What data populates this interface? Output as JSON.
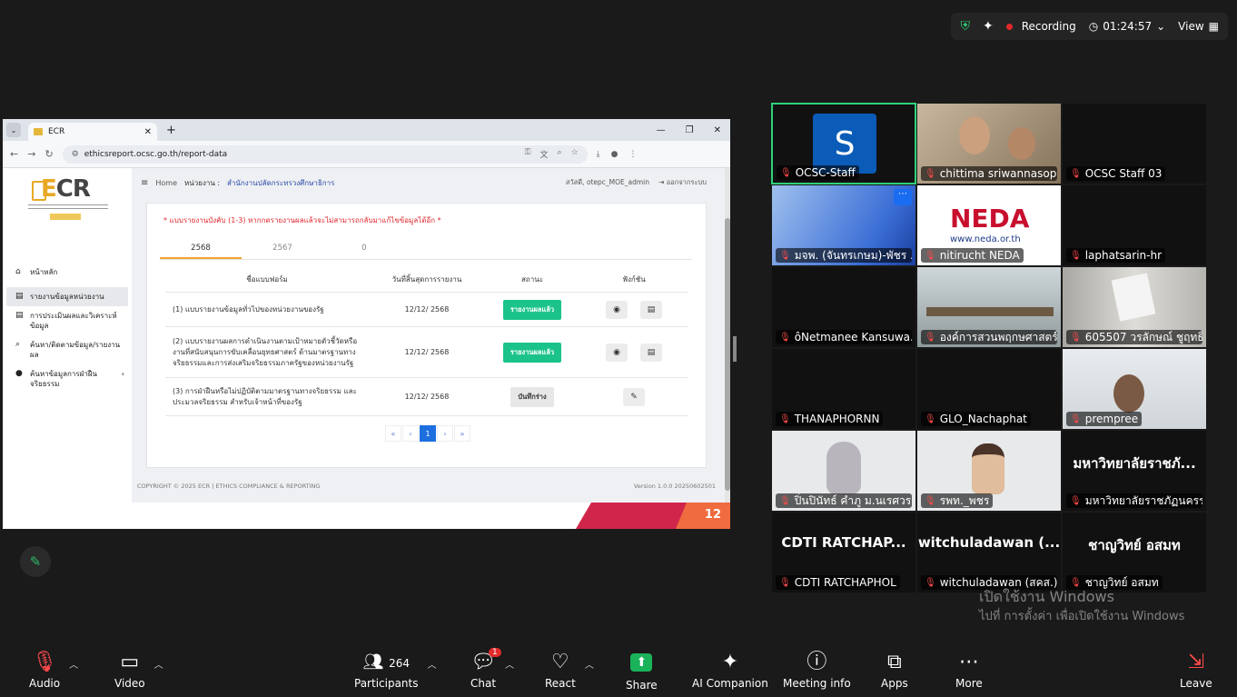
{
  "topbar": {
    "recording": "Recording",
    "timer": "01:24:57",
    "view": "View"
  },
  "browser": {
    "tab_title": "ECR",
    "url": "ethicsreport.ocsc.go.th/report-data"
  },
  "page": {
    "breadcrumb": {
      "home": "Home",
      "unit_label": "หน่วยงาน :",
      "org": "สำนักงานปลัดกระทรวงศึกษาธิการ"
    },
    "user": {
      "greeting": "สวัสดี, otepc_MOE_admin",
      "logout": "ออกจากระบบ"
    },
    "logo": {
      "text_e": "E",
      "text_rest": "CR"
    },
    "menu": [
      {
        "icon": "home-icon",
        "glyph": "⌂",
        "label": "หน้าหลัก"
      },
      {
        "icon": "document-icon",
        "glyph": "▤",
        "label": "รายงานข้อมูลหน่วยงาน"
      },
      {
        "icon": "document-icon",
        "glyph": "▤",
        "label": "การประเมินผลและวิเคราะห์ข้อมูล"
      },
      {
        "icon": "search-icon",
        "glyph": "⌕",
        "label": "ค้นหา/ติดตามข้อมูล/รายงานผล"
      },
      {
        "icon": "circle-icon",
        "glyph": "●",
        "label": "ค้นหาข้อมูลการฝ่าฝืนจริยธรรม"
      }
    ],
    "warning": "* แบบรายงานบังคับ (1-3) หากกดรายงานผลแล้วจะไม่สามารถกลับมาแก้ไขข้อมูลได้อีก *",
    "year_tabs": [
      "2568",
      "2567",
      "0"
    ],
    "columns": [
      "ชื่อแบบฟอร์ม",
      "วันที่สิ้นสุดการรายงาน",
      "สถานะ",
      "ฟังก์ชัน"
    ],
    "rows": [
      {
        "form": "(1) แบบรายงานข้อมูลทั่วไปของหน่วยงานของรัฐ",
        "date": "12/12/ 2568",
        "status": "รายงานผลแล้ว"
      },
      {
        "form": "(2) แบบรายงานผลการดำเนินงานตามเป้าหมายตัวชี้วัดหรืองานที่สนับสนุนการขับเคลื่อนยุทธศาสตร์ ด้านมาตรฐานทางจริยธรรมและการส่งเสริมจริยธรรมภาครัฐของหน่วยงานรัฐ",
        "date": "12/12/ 2568",
        "status": "รายงานผลแล้ว"
      },
      {
        "form": "(3) การฝ่าฝืนหรือไม่ปฏิบัติตามมาตรฐานทางจริยธรรม และประมวลจริยธรรม สำหรับเจ้าหน้าที่ของรัฐ",
        "date": "12/12/ 2568",
        "status": "บันทึกร่าง"
      }
    ],
    "pager": [
      "«",
      "‹",
      "1",
      "›",
      "»"
    ],
    "footer_left": "COPYRIGHT © 2025 ECR | ETHICS COMPLIANCE & REPORTING",
    "footer_right": "Version 1.0.0 20250602501",
    "slide_number": "12"
  },
  "participants": [
    {
      "name": "OCSC-Staff"
    },
    {
      "name": "chittima sriwannasop..."
    },
    {
      "name": "OCSC Staff 03"
    },
    {
      "name": "มจพ. (จันทรเกษม)-พัชร ..."
    },
    {
      "name": "nitirucht NEDA"
    },
    {
      "name": "laphatsarin-hr"
    },
    {
      "name": "ô‌Netmanee Kansuwa..."
    },
    {
      "name": "องค์การสวนพฤกษศาสตร์"
    },
    {
      "name": "605507 วรลักษณ์ ชูฤทธิ์"
    },
    {
      "name": "THANAPHORNN"
    },
    {
      "name": "GLO_Nachaphat"
    },
    {
      "name": "prempree"
    },
    {
      "name": "ปิ่นปินัทธ์ คำภู ม.นเรศวร"
    },
    {
      "name": "รพท._พชร"
    },
    {
      "name": "มหาวิทยาลัยราชภัฏนครร...",
      "big": "มหาวิทยาลัยราชภั..."
    },
    {
      "name": "CDTI RATCHAPHOL",
      "big": "CDTI  RATCHAP..."
    },
    {
      "name": "witchuladawan (สคส.)",
      "big": "witchuladawan  (..."
    },
    {
      "name": "ชาญวิทย์ อสมท",
      "big": "ชาญวิทย์  อสมท"
    }
  ],
  "neda": {
    "logo": "NEDA",
    "url": "www.neda.or.th"
  },
  "watermark": {
    "line1": "เปิดใช้งาน Windows",
    "line2": "ไปที่ การตั้งค่า เพื่อเปิดใช้งาน Windows"
  },
  "toolbar": {
    "audio": "Audio",
    "video": "Video",
    "participants": "Participants",
    "participants_count": "264",
    "chat": "Chat",
    "chat_badge": "1",
    "react": "React",
    "share": "Share",
    "ai": "AI Companion",
    "meeting_info": "Meeting info",
    "apps": "Apps",
    "more": "More",
    "leave": "Leave"
  }
}
